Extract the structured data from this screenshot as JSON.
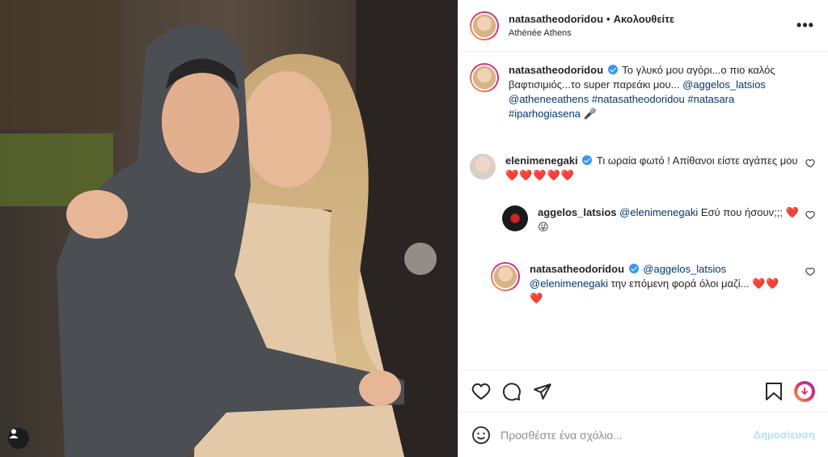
{
  "colors": {
    "link": "#00376b",
    "verified": "#3897f0",
    "heart": "#e0245e",
    "post_disabled": "#b2dffc"
  },
  "header": {
    "username": "natasatheodoridou",
    "separator": "•",
    "follow_status": "Ακολουθείτε",
    "location": "Athénée Athens",
    "more_icon": "more-horizontal-icon"
  },
  "caption": {
    "username": "natasatheodoridou",
    "text": "Το γλυκό μου αγόρι...ο πιο καλός βαφτισιμιός...το super παρεάκι μου...",
    "mention": "@aggelos_latsios",
    "tags": "@atheneeathens #natasatheodoridou #natasara #iparhogiasena",
    "emoji": "🎤"
  },
  "comments": [
    {
      "username": "elenimenegaki",
      "verified": true,
      "text": "Τι ωραία φωτό ! Απίθανοι είστε αγάπες μου",
      "hearts": "❤️❤️❤️❤️❤️"
    },
    {
      "username": "aggelos_latsios",
      "mention": "@elenimenegaki",
      "text": "Εσύ που ήσουν;;;",
      "heart": "❤️",
      "emoji": "😜"
    },
    {
      "username": "natasatheodoridou",
      "verified": true,
      "mention": "@aggelos_latsios",
      "mention2": "@elenimenegaki",
      "text": "την επόμενη φορά όλοι μαζί...",
      "hearts": "❤️❤️",
      "heart_line2": "❤️"
    }
  ],
  "actions": {
    "like": "heart-icon",
    "comment": "comment-icon",
    "share": "share-icon",
    "save": "bookmark-icon"
  },
  "add_comment": {
    "placeholder": "Προσθέστε ένα σχόλιο...",
    "post_label": "Δημοσίευση",
    "emoji_icon": "smiley-icon"
  }
}
